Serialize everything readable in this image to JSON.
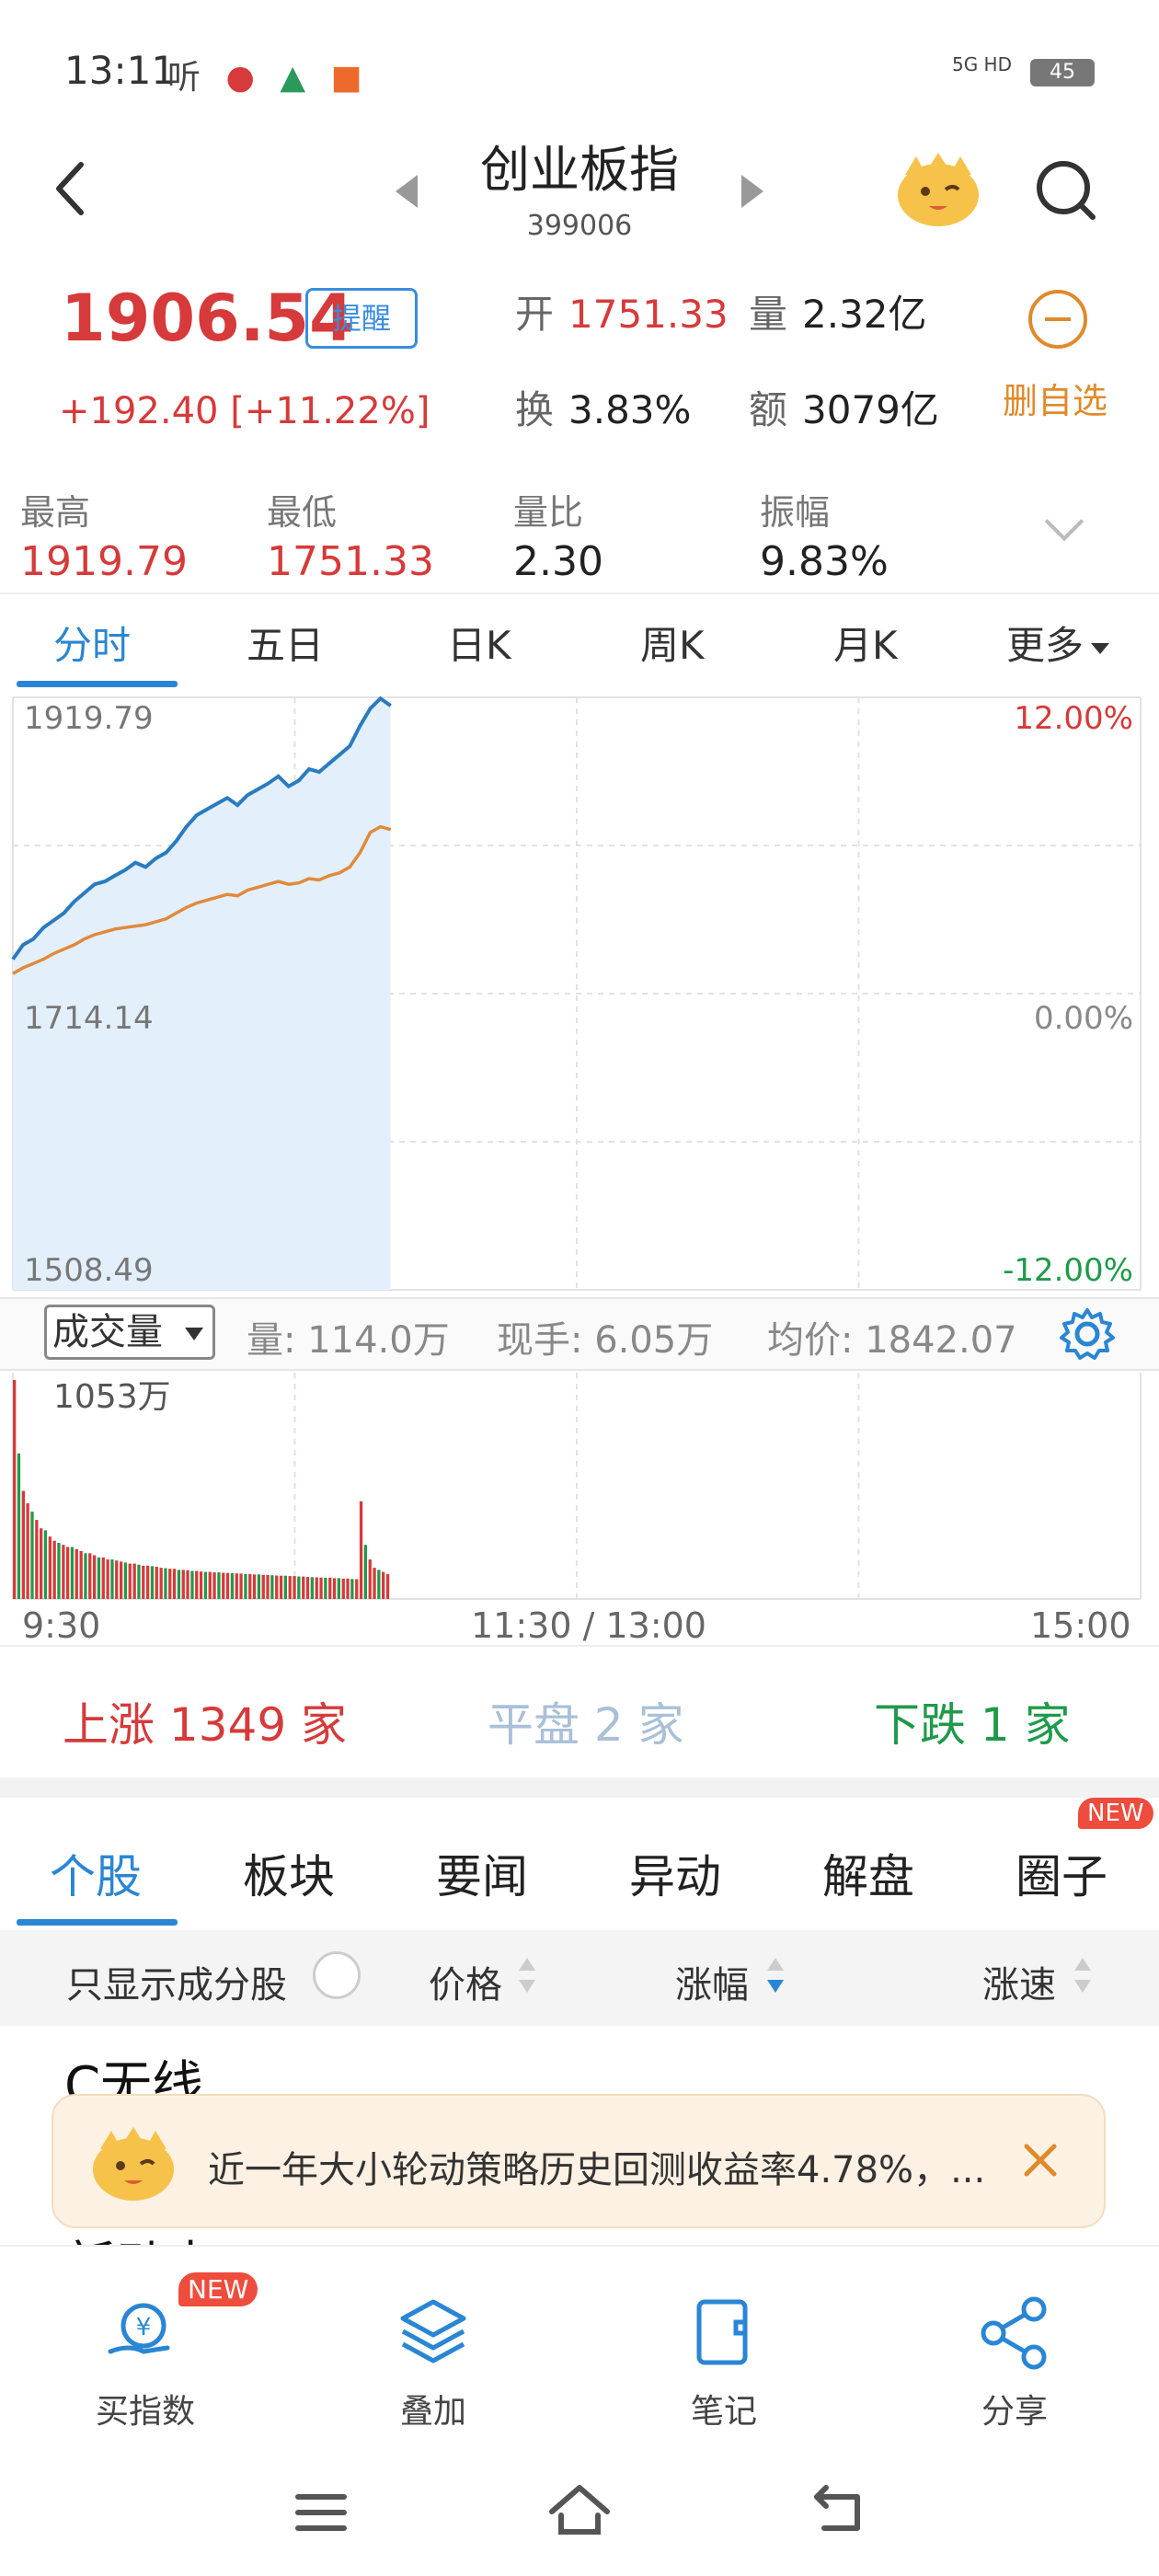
{
  "status_bar": {
    "time": "13:11",
    "icons_text": "听",
    "network": "5G HD",
    "battery": "45"
  },
  "header": {
    "title": "创业板指",
    "code": "399006"
  },
  "quote": {
    "price": "1906.54",
    "remind_label": "提醒",
    "change": "+192.40  [+11.22%]",
    "open_label": "开",
    "open_value": "1751.33",
    "volume_label": "量",
    "volume_value": "2.32亿",
    "turnover_label": "换",
    "turnover_value": "3.83%",
    "amount_label": "额",
    "amount_value": "3079亿",
    "remove_label": "删自选"
  },
  "stats": [
    {
      "label": "最高",
      "value": "1919.79"
    },
    {
      "label": "最低",
      "value": "1751.33"
    },
    {
      "label": "量比",
      "value": "2.30"
    },
    {
      "label": "振幅",
      "value": "9.83%"
    }
  ],
  "period_tabs": [
    "分时",
    "五日",
    "日K",
    "周K",
    "月K",
    "更多"
  ],
  "chart_data": {
    "type": "line",
    "title": "",
    "y_left_ticks": [
      "1919.79",
      "1714.14",
      "1508.49"
    ],
    "y_right_ticks": [
      "12.00%",
      "0.00%",
      "-12.00%"
    ],
    "ylim": [
      1508.49,
      1919.79
    ],
    "x_tick_labels": [
      "9:30",
      "11:30 / 13:00",
      "15:00"
    ],
    "series": [
      {
        "color": "#2a7bbf",
        "values": [
          1738,
          1748,
          1752,
          1760,
          1765,
          1770,
          1778,
          1784,
          1790,
          1792,
          1796,
          1800,
          1805,
          1802,
          1808,
          1812,
          1820,
          1830,
          1838,
          1842,
          1846,
          1850,
          1845,
          1852,
          1856,
          1860,
          1865,
          1858,
          1862,
          1870,
          1868,
          1874,
          1880,
          1886,
          1900,
          1912,
          1919,
          1914
        ]
      },
      {
        "color": "#e08a3c",
        "values": [
          1728,
          1732,
          1735,
          1738,
          1742,
          1745,
          1748,
          1752,
          1755,
          1757,
          1759,
          1760,
          1761,
          1762,
          1764,
          1766,
          1770,
          1774,
          1777,
          1779,
          1781,
          1783,
          1782,
          1786,
          1788,
          1790,
          1792,
          1790,
          1791,
          1794,
          1793,
          1796,
          1798,
          1802,
          1812,
          1826,
          1830,
          1828
        ]
      }
    ]
  },
  "volume": {
    "selector_label": "成交量",
    "vol_text": "量: 114.0万",
    "current_text": "现手: 6.05万",
    "avg_text": "均价: 1842.07",
    "max_label": "1053万"
  },
  "volume_chart_data": {
    "type": "bar",
    "ylim": [
      0,
      1053
    ],
    "values": [
      1053,
      700,
      520,
      460,
      420,
      380,
      340,
      330,
      300,
      280,
      270,
      260,
      250,
      250,
      240,
      230,
      220,
      220,
      210,
      200,
      200,
      190,
      190,
      185,
      180,
      175,
      170,
      170,
      165,
      160,
      160,
      158,
      155,
      150,
      148,
      145,
      145,
      140,
      140,
      138,
      135,
      135,
      132,
      130,
      130,
      128,
      128,
      126,
      125,
      124,
      123,
      122,
      120,
      120,
      118,
      118,
      116,
      115,
      114,
      113,
      112,
      112,
      110,
      110,
      108,
      108,
      106,
      105,
      104,
      103,
      102,
      102,
      100,
      100,
      98,
      98,
      96,
      95,
      470,
      260,
      190,
      150,
      140,
      130,
      120
    ],
    "colors_pattern": [
      "#d63a3a",
      "#1f9a4a"
    ]
  },
  "breadth": {
    "up": "上涨 1349 家",
    "flat": "平盘 2 家",
    "down": "下跌 1 家"
  },
  "bottom_tabs": [
    "个股",
    "板块",
    "要闻",
    "异动",
    "解盘",
    "圈子"
  ],
  "new_badge": "NEW",
  "list_header": {
    "only_components": "只显示成分股",
    "price": "价格",
    "change": "涨幅",
    "speed": "涨速"
  },
  "rows": [
    "C无线",
    "新动力"
  ],
  "toast": {
    "text": "近一年大小轮动策略历史回测收益率4.78%，..."
  },
  "bottom_nav": [
    {
      "label": "买指数",
      "icon": "buy-index-icon"
    },
    {
      "label": "叠加",
      "icon": "layers-icon"
    },
    {
      "label": "笔记",
      "icon": "note-icon"
    },
    {
      "label": "分享",
      "icon": "share-icon"
    }
  ],
  "colors": {
    "up": "#d63a3a",
    "down": "#1f9a4a",
    "accent": "#2a86d4",
    "orange": "#e08a2a"
  }
}
